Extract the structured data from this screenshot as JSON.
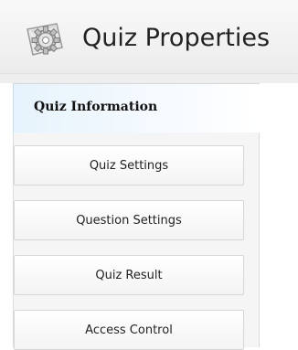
{
  "header": {
    "title": "Quiz Properties",
    "icon": "gear-document-icon"
  },
  "sidebar": {
    "active_tab": "Quiz Information",
    "items": [
      {
        "label": "Quiz Settings"
      },
      {
        "label": "Question Settings"
      },
      {
        "label": "Quiz Result"
      },
      {
        "label": "Access Control"
      }
    ]
  },
  "colors": {
    "active_tab_bg": "#e6f3fc",
    "header_bg": "#f0f0f0",
    "border": "#d6d6d6"
  }
}
